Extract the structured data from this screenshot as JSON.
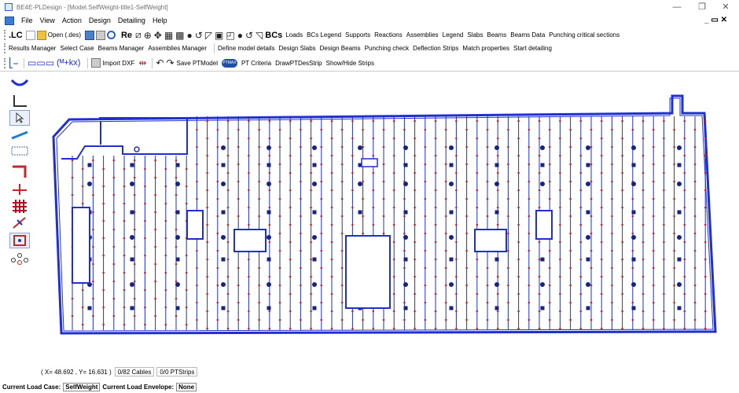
{
  "window": {
    "title": "BE4E-PLDesign - [Model.SelfWeight-title1-SelfWeight]",
    "minimize": "—",
    "restore": "❐",
    "close": "✕",
    "mdi_restore": "_ ▭ ✕"
  },
  "menu": [
    "File",
    "View",
    "Action",
    "Design",
    "Detailing",
    "Help"
  ],
  "toolbar1": {
    "lc_label": ".LC",
    "open_label": "Open (.des)",
    "re_label": "Re",
    "bcs_label": "BCs",
    "links": [
      "Loads",
      "BCs Legend",
      "Supports",
      "Reactions",
      "Assemblies",
      "Legend",
      "Slabs",
      "Beams",
      "Beams Data",
      "Punching critical sections"
    ]
  },
  "toolbar2": {
    "group1": [
      "Results Manager",
      "Select Case",
      "Beams Manager",
      "Assemblies Manager"
    ],
    "group2": [
      "Define model details",
      "Design Slabs",
      "Design Beams",
      "Punching check",
      "Deflection Strips",
      "Match properties",
      "Start detailing"
    ]
  },
  "toolbar3": {
    "formula": "(ᴹ+kx)",
    "import_dxf": "Import DXF",
    "save_pt": "Save PTModel",
    "pt_badge": "PTMAX",
    "pt_criteria": "PT Criteria",
    "draw_strip": "DrawPTDesStrip",
    "show_hide": "Show/Hide Strips"
  },
  "status": {
    "coords": "( X= 48.692 , Y= 16.631 )",
    "cables": "0/82 Cables",
    "ptstrips": "0/0 PTStrips"
  },
  "loadbar": {
    "case_label": "Current Load Case:",
    "case_value": "SelfWeight",
    "envelope_label": "Current Load Envelope:",
    "envelope_value": "None"
  },
  "colors": {
    "model_blue": "#1f2fd0",
    "node_red": "#c0282c",
    "column_navy": "#1a237e"
  }
}
